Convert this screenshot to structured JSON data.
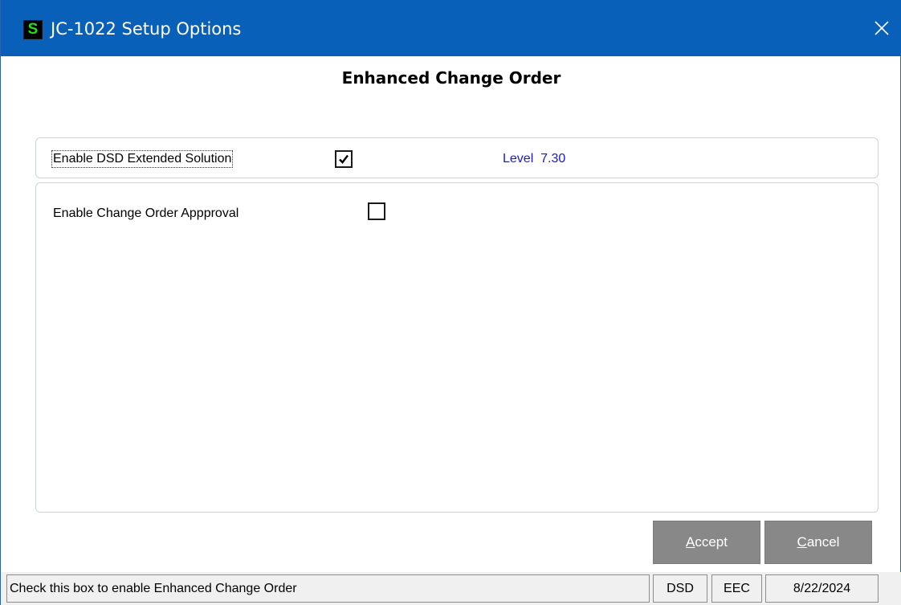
{
  "window": {
    "title": "JC-1022 Setup Options",
    "app_icon_letter": "S",
    "close_glyph": "✕"
  },
  "form": {
    "heading": "Enhanced Change Order"
  },
  "options": {
    "extended_solution": {
      "label": "Enable DSD Extended Solution",
      "checked": true,
      "check_glyph": "✔"
    },
    "level": "Level  7.30",
    "change_order_approval": {
      "label": "Enable Change Order Appproval",
      "checked": false
    }
  },
  "buttons": {
    "accept": {
      "hotkey": "A",
      "rest": "ccept"
    },
    "cancel": {
      "hotkey": "C",
      "rest": "ancel"
    }
  },
  "statusbar": {
    "message": "Check this box to enable Enhanced Change Order",
    "company": "DSD",
    "module": "EEC",
    "date": "8/22/2024"
  },
  "colors": {
    "titlebar": "#0860b8",
    "level_text": "#1a1acc",
    "button_bg": "#888888",
    "app_icon_letter": "#22e01a"
  },
  "icons": {
    "app": "sage-s-icon",
    "close": "close-icon",
    "check": "checkmark-icon"
  }
}
